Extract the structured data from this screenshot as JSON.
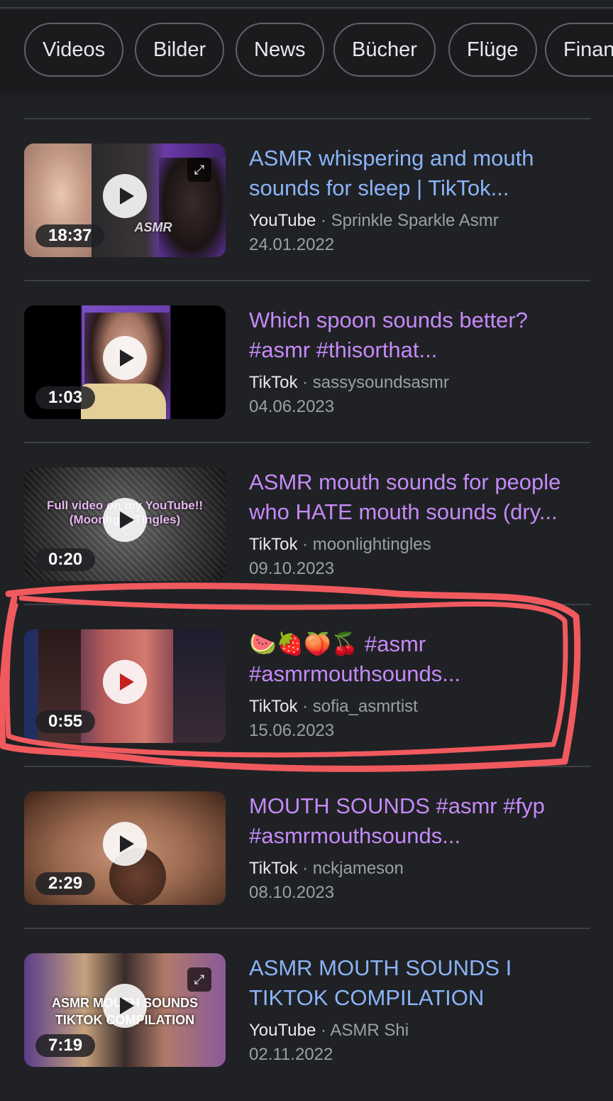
{
  "chips": [
    "Videos",
    "Bilder",
    "News",
    "Bücher",
    "Flüge",
    "Finan"
  ],
  "results": [
    {
      "duration": "18:37",
      "title": "ASMR whispering and mouth sounds for sleep | TikTok...",
      "source": "YouTube",
      "channel": "Sprinkle Sparkle Asmr",
      "date": "24.01.2022",
      "title_color": "#8ab4f8",
      "thumb_overlay": "ASMR"
    },
    {
      "duration": "1:03",
      "title": "Which spoon sounds better? #asmr #thisorthat...",
      "source": "TikTok",
      "channel": "sassysoundsasmr",
      "date": "04.06.2023",
      "title_color": "#c58af9"
    },
    {
      "duration": "0:20",
      "title": "ASMR mouth sounds for people who HATE mouth sounds (dry...",
      "source": "TikTok",
      "channel": "moonlightingles",
      "date": "09.10.2023",
      "title_color": "#c58af9",
      "thumb_overlay": "Full video on my YouTube!! (Moonlight Tingles)"
    },
    {
      "duration": "0:55",
      "title": "🍉🍓🍑🍒 #asmr #asmrmouthsounds...",
      "source": "TikTok",
      "channel": "sofia_asmrtist",
      "date": "15.06.2023",
      "title_color": "#c58af9",
      "highlighted": true
    },
    {
      "duration": "2:29",
      "title": "MOUTH SOUNDS #asmr #fyp #asmrmouthsounds...",
      "source": "TikTok",
      "channel": "nckjameson",
      "date": "08.10.2023",
      "title_color": "#c58af9"
    },
    {
      "duration": "7:19",
      "title": "ASMR MOUTH SOUNDS I TIKTOK COMPILATION",
      "source": "YouTube",
      "channel": "ASMR Shi",
      "date": "02.11.2022",
      "title_color": "#8ab4f8",
      "thumb_overlay": "ASMR MOUTH SOUNDS TIKTOK COMPILATION"
    }
  ],
  "colors": {
    "background": "#202124",
    "link_unvisited": "#8ab4f8",
    "link_visited": "#c58af9",
    "annotation": "#f05a5e"
  },
  "icons": [
    "play-icon",
    "expand-icon"
  ]
}
